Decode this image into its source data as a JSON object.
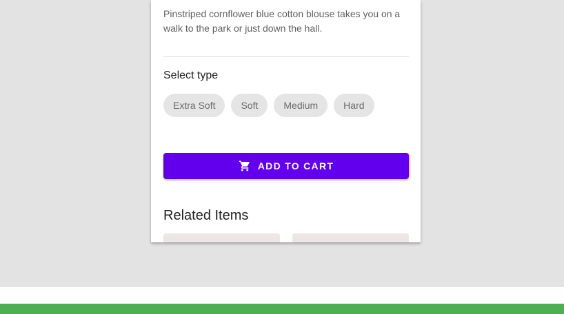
{
  "product": {
    "description": "Pinstriped cornflower blue cotton blouse takes you on a walk to the park or just down the hall."
  },
  "type_selector": {
    "label": "Select type",
    "options": [
      "Extra Soft",
      "Soft",
      "Medium",
      "Hard"
    ]
  },
  "cart_button": {
    "label": "ADD TO CART",
    "icon": "cart-icon"
  },
  "related": {
    "title": "Related Items"
  },
  "colors": {
    "accent": "#6200ee",
    "bottom_bar": "#4caf50",
    "background": "#e3e3e3"
  }
}
